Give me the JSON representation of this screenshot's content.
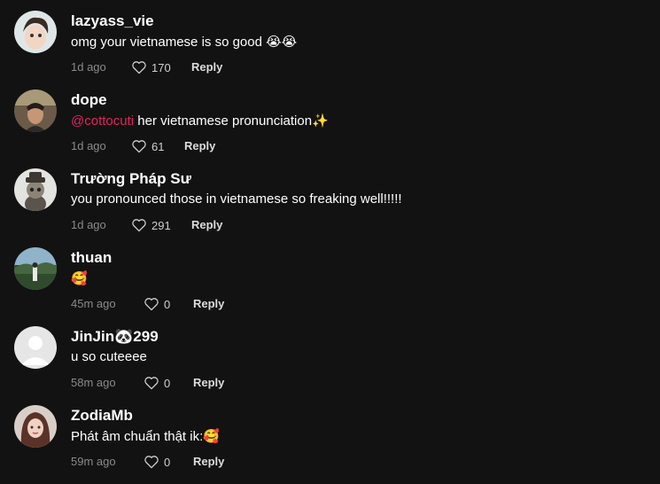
{
  "comments": [
    {
      "username": "lazyass_vie",
      "text": "omg your vietnamese is so good 😭😭",
      "time": "1d ago",
      "likes": "170",
      "reply": "Reply"
    },
    {
      "username": "dope",
      "mention": "@cottocuti",
      "text": " her vietnamese pronunciation✨",
      "time": "1d ago",
      "likes": "61",
      "reply": "Reply"
    },
    {
      "username": "Trường Pháp Sư",
      "text": "you pronounced those in vietnamese so freaking well!!!!!",
      "time": "1d ago",
      "likes": "291",
      "reply": "Reply"
    },
    {
      "username": "thuan",
      "text": "🥰",
      "time": "45m ago",
      "likes": "0",
      "reply": "Reply"
    },
    {
      "username": "JinJin🐼299",
      "text": "u so cuteeee",
      "time": "58m ago",
      "likes": "0",
      "reply": "Reply"
    },
    {
      "username": "ZodiaMb",
      "text": "Phát âm chuẩn thật ik:🥰",
      "time": "59m ago",
      "likes": "0",
      "reply": "Reply"
    }
  ]
}
